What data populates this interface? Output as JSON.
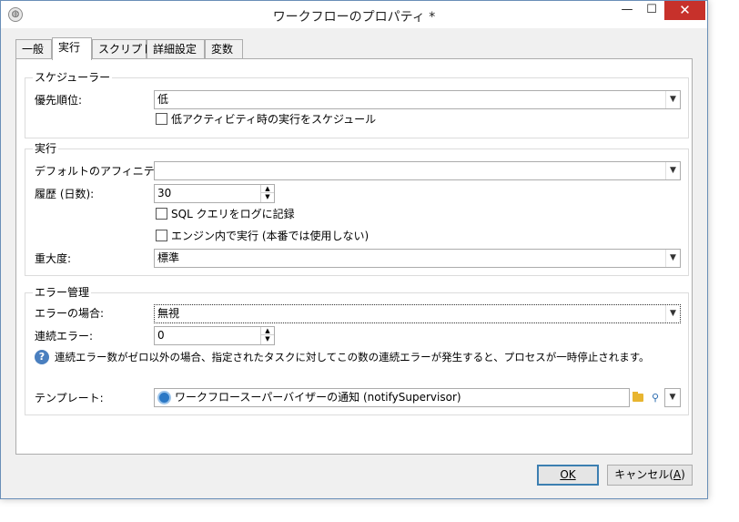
{
  "window": {
    "title": "ワークフローのプロパティ *",
    "minimize": "—",
    "maximize": "☐",
    "close": "✕"
  },
  "tabs": [
    {
      "label": "一般"
    },
    {
      "label": "実行"
    },
    {
      "label": "スクリプト"
    },
    {
      "label": "詳細設定"
    },
    {
      "label": "変数"
    }
  ],
  "scheduler": {
    "title": "スケジューラー",
    "priority_label": "優先順位:",
    "priority_value": "低",
    "low_activity_checkbox": "低アクティビティ時の実行をスケジュール"
  },
  "execution": {
    "title": "実行",
    "affinity_label": "デフォルトのアフィニティ:",
    "affinity_value": "",
    "history_label": "履歴 (日数):",
    "history_value": "30",
    "sql_checkbox": "SQL クエリをログに記録",
    "engine_checkbox": "エンジン内で実行 (本番では使用しない)",
    "severity_label": "重大度:",
    "severity_value": "標準"
  },
  "error_management": {
    "title": "エラー管理",
    "on_error_label": "エラーの場合:",
    "on_error_value": "無視",
    "consecutive_label": "連続エラー:",
    "consecutive_value": "0",
    "info_text": "連続エラー数がゼロ以外の場合、指定されたタスクに対してこの数の連続エラーが発生すると、プロセスが一時停止されます。",
    "template_label": "テンプレート:",
    "template_value": "ワークフロースーパーバイザーの通知 (notifySupervisor)"
  },
  "buttons": {
    "ok": "OK",
    "cancel_prefix": "キャンセル(",
    "cancel_key": "A",
    "cancel_suffix": ")"
  },
  "icons": {
    "app": "workflow-app-icon",
    "info": "info-icon",
    "template": "template-icon",
    "folder": "folder-icon",
    "search": "search-icon",
    "dropdown": "chevron-down-icon"
  },
  "colors": {
    "close_button": "#c7312b",
    "accent": "#3c7fb1",
    "info": "#4a7fbf",
    "folder": "#e8b530"
  }
}
